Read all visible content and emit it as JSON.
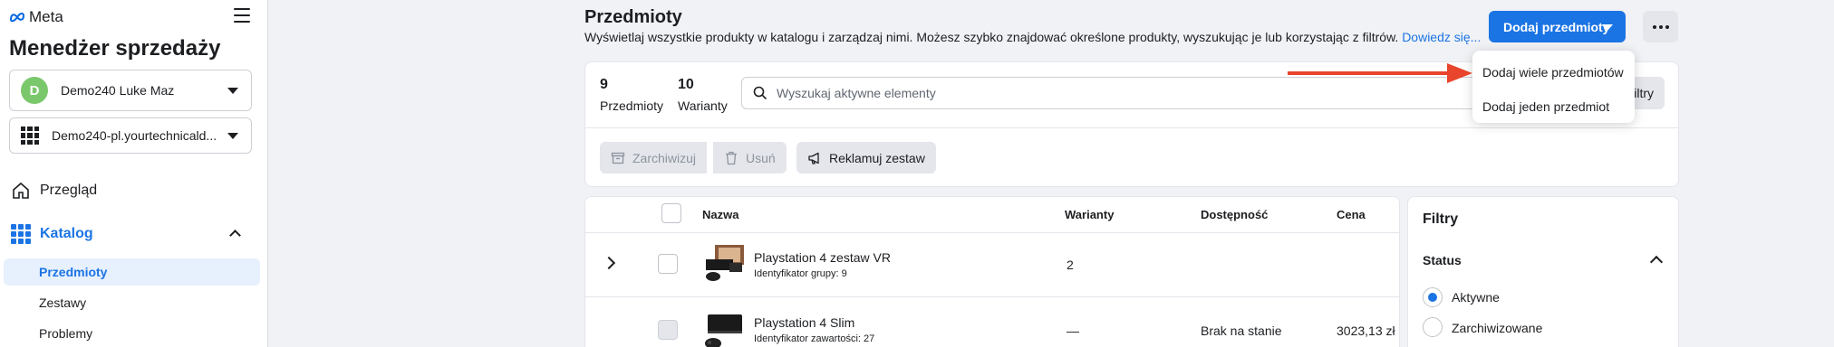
{
  "sidebar": {
    "brand": "Meta",
    "app_title": "Menedżer sprzedaży",
    "account": {
      "avatar_letter": "D",
      "name": "Demo240 Luke Maz"
    },
    "catalog_select": "Demo240-pl.yourtechnicald...",
    "nav": {
      "overview": "Przegląd",
      "catalog": "Katalog",
      "sub": [
        "Przedmioty",
        "Zestawy",
        "Problemy"
      ]
    }
  },
  "header": {
    "title": "Przedmioty",
    "description": "Wyświetlaj wszystkie produkty w katalogu i zarządzaj nimi. Możesz szybko znajdować określone produkty, wyszukując je lub korzystając z filtrów.",
    "learn_more": "Dowiedz się...",
    "add_button": "Dodaj przedmioty"
  },
  "dropdown": {
    "items": [
      "Dodaj wiele przedmiotów",
      "Dodaj jeden przedmiot"
    ]
  },
  "toolbar": {
    "items_count": "9",
    "items_label": "Przedmioty",
    "variants_count": "10",
    "variants_label": "Warianty",
    "search_placeholder": "Wyszukaj aktywne elementy",
    "filters_label": "Filtry",
    "archive_label": "Zarchiwizuj",
    "delete_label": "Usuń",
    "advertise_label": "Reklamuj zestaw"
  },
  "table": {
    "columns": [
      "Nazwa",
      "Warianty",
      "Dostępność",
      "Cena"
    ],
    "rows": [
      {
        "name": "Playstation 4 zestaw VR",
        "sub": "Identyfikator grupy: 9",
        "variants": "2",
        "availability": "",
        "price": ""
      },
      {
        "name": "Playstation 4 Slim",
        "sub": "Identyfikator zawartości: 27",
        "variants": "—",
        "availability": "Brak na stanie",
        "price": "3023,13 zł"
      }
    ]
  },
  "filters": {
    "title": "Filtry",
    "status_title": "Status",
    "options": [
      "Aktywne",
      "Zarchiwizowane"
    ]
  },
  "colors": {
    "accent": "#1b74e4",
    "arrow": "#e8452c",
    "avatar": "#7bc86c"
  }
}
